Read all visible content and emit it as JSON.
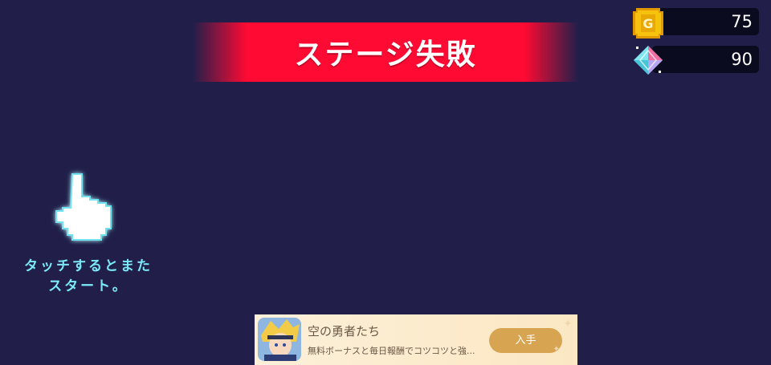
{
  "header": {
    "title": "ステージ失敗"
  },
  "currencies": {
    "coins": "75",
    "gems": "90"
  },
  "hint": {
    "line1": "タッチするとまた",
    "line2": "スタート。"
  },
  "ad": {
    "title": "空の勇者たち",
    "description": "無料ボーナスと毎日報酬でコツコツと強...",
    "button": "入手"
  },
  "colors": {
    "background": "#211f4a",
    "banner": "#ff0a33",
    "hint": "#7be9f6",
    "coin": "#f4b400",
    "ad_button": "#d7a552"
  },
  "icons": [
    "coin-icon",
    "gem-icon",
    "pointing-hand-icon",
    "game-character-icon"
  ]
}
